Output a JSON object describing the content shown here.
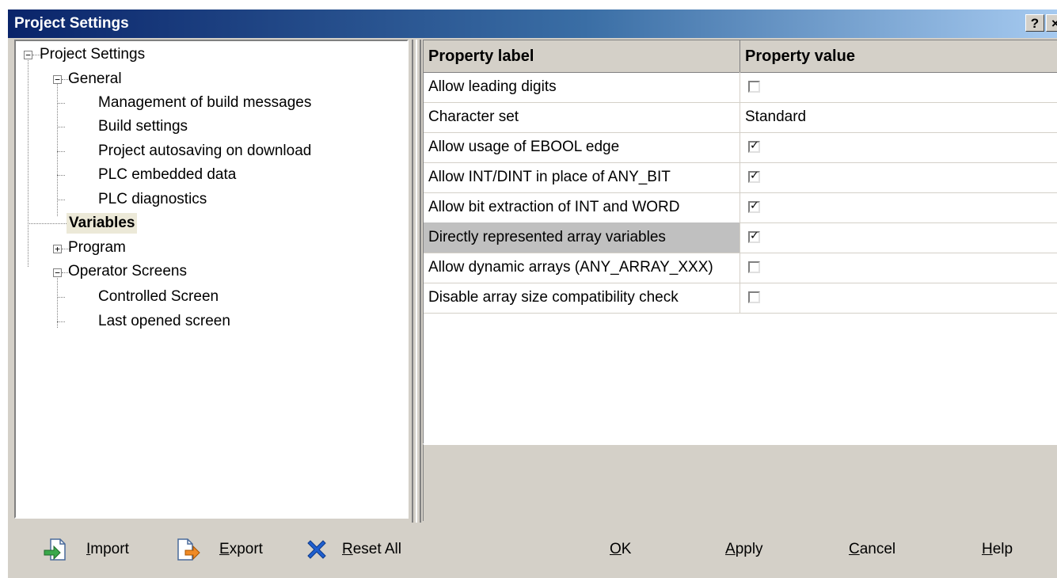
{
  "window": {
    "title": "Project Settings",
    "help_btn": "?",
    "close_btn": "×"
  },
  "tree": {
    "root": "Project Settings",
    "general": "General",
    "management_build_msgs": "Management of build messages",
    "build_settings": "Build settings",
    "autosave": "Project autosaving on download",
    "plc_embedded": "PLC embedded data",
    "plc_diag": "PLC diagnostics",
    "variables": "Variables",
    "program": "Program",
    "operator_screens": "Operator Screens",
    "controlled_screen": "Controlled Screen",
    "last_opened": "Last opened screen"
  },
  "grid": {
    "col_label": "Property label",
    "col_value": "Property value",
    "rows": [
      {
        "label": "Allow leading digits",
        "type": "checkbox",
        "checked": false
      },
      {
        "label": "Character set",
        "type": "text",
        "value": "Standard"
      },
      {
        "label": "Allow usage of EBOOL edge",
        "type": "checkbox",
        "checked": true
      },
      {
        "label": "Allow INT/DINT in place of ANY_BIT",
        "type": "checkbox",
        "checked": true
      },
      {
        "label": "Allow bit extraction of INT and WORD",
        "type": "checkbox",
        "checked": true
      },
      {
        "label": "Directly represented array variables",
        "type": "checkbox",
        "checked": true,
        "selected": true
      },
      {
        "label": "Allow dynamic arrays (ANY_ARRAY_XXX)",
        "type": "checkbox",
        "checked": false
      },
      {
        "label": "Disable array size compatibility check",
        "type": "checkbox",
        "checked": false
      }
    ]
  },
  "buttons": {
    "import_rest": "mport",
    "import_key": "I",
    "export_rest": "xport",
    "export_key": "E",
    "reset_rest": "eset All",
    "reset_key": "R",
    "ok_rest": "K",
    "ok_key": "O",
    "apply_rest": "pply",
    "apply_key": "A",
    "cancel_rest": "ancel",
    "cancel_key": "C",
    "help_rest": "elp",
    "help_key": "H"
  },
  "colors": {
    "title_start": "#0a246a",
    "title_end": "#a6caf0",
    "face": "#d4d0c8"
  }
}
